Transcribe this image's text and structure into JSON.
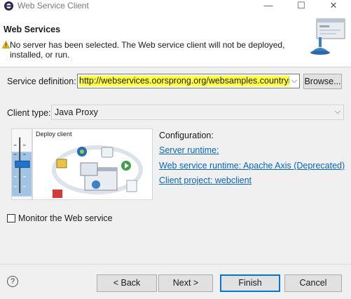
{
  "window": {
    "title": "Web Service Client",
    "minimize": "—",
    "maximize": "☐",
    "close": "✕"
  },
  "header": {
    "title": "Web Services",
    "message": "No server has been selected. The Web service client will not be deployed, installed, or run."
  },
  "service_definition": {
    "label": "Service definition:",
    "value": "http://webservices.oorsprong.org/websamples.countryinfo",
    "highlight_color": "#ffff3c"
  },
  "browse_label": "Browse...",
  "client_type": {
    "label": "Client type:",
    "value": "Java Proxy"
  },
  "graphic": {
    "caption": "Deploy client",
    "slider_level": "Deploy"
  },
  "configuration": {
    "label": "Configuration:",
    "server_runtime": "Server runtime: ",
    "ws_runtime": "Web service runtime: Apache Axis (Deprecated)",
    "client_project": "Client project: webclient"
  },
  "monitor_label": "Monitor the Web service",
  "footer": {
    "help": "?",
    "back": "< Back",
    "next": "Next >",
    "finish": "Finish",
    "cancel": "Cancel"
  },
  "colors": {
    "link": "#0a65c0",
    "default_button_border": "#0078d7"
  }
}
